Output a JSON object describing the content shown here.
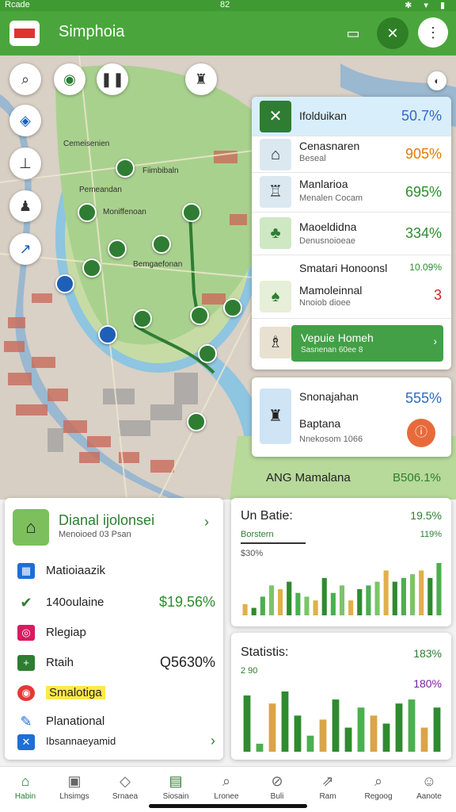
{
  "status": {
    "left": "Rcade",
    "center": "82"
  },
  "app": {
    "title": "Simphoia"
  },
  "map": {
    "labels": [
      "Cemeisenien",
      "Fiimbibaln",
      "Pemeandan",
      "Moniffenoan",
      "Bemgaefonan"
    ],
    "list": [
      {
        "title": "Ifolduikan",
        "value": "50.7%"
      },
      {
        "title": "Cenasnaren",
        "sub": "Beseal",
        "value": "905%"
      },
      {
        "title": "Manlarioa",
        "sub": "Menalen Cocam",
        "value": "695%"
      },
      {
        "title": "Maoeldidna",
        "sub": "Denusnoioeae",
        "value": "334%"
      },
      {
        "title": "Smatari Honoonsl",
        "value": "10.09%"
      },
      {
        "title": "Mamoleinnal",
        "sub": "Nnoiob dioee",
        "value": "3"
      },
      {
        "title": "Vepuie Homeh",
        "sub": "Sasnenan 60ee 8"
      }
    ],
    "card": {
      "title": "Snonajahan",
      "value": "555%",
      "title2": "Baptana",
      "sub2": "Nnekosom 1066"
    },
    "footer_label": "ANG Mamalana",
    "footer_value": "B506.1%"
  },
  "left_panel": {
    "title": "Dianal ijolonsei",
    "sub": "Menoioed 03 Psan",
    "items": [
      {
        "label": "Matioiaazik",
        "value": ""
      },
      {
        "label": "140oulaine",
        "value": "$19.56%"
      },
      {
        "label": "Rlegiap",
        "value": ""
      },
      {
        "label": "Rtaih",
        "value": "Q5630%"
      },
      {
        "label": "Smalotiga",
        "value": ""
      },
      {
        "label": "Planational",
        "value": ""
      },
      {
        "label": "Ibsannaeyamid",
        "value": ""
      }
    ]
  },
  "stats1": {
    "title": "Un Batie:",
    "value": "19.5%",
    "sub": "Borstern",
    "sub_val": "119%",
    "ymax": "$30%"
  },
  "stats2": {
    "title": "Statistis:",
    "value": "183%",
    "sub": "2 90",
    "sub_val": "180%"
  },
  "chart_data": [
    {
      "type": "bar",
      "series": [
        {
          "values": [
            3,
            2,
            5,
            8,
            7,
            9,
            6,
            5,
            4,
            10,
            6,
            8,
            4,
            7,
            8,
            9,
            12,
            9,
            10,
            11,
            12,
            10,
            14
          ]
        }
      ]
    },
    {
      "type": "bar",
      "series": [
        {
          "values": [
            14,
            2,
            12,
            15,
            9,
            4,
            8,
            13,
            6,
            11,
            9,
            7,
            12,
            13,
            6,
            11
          ]
        }
      ]
    }
  ],
  "nav": [
    "Habin",
    "Lhsimgs",
    "Srnaea",
    "Siosain",
    "Lronee",
    "Buli",
    "Ram",
    "Regoog",
    "Aanote"
  ]
}
